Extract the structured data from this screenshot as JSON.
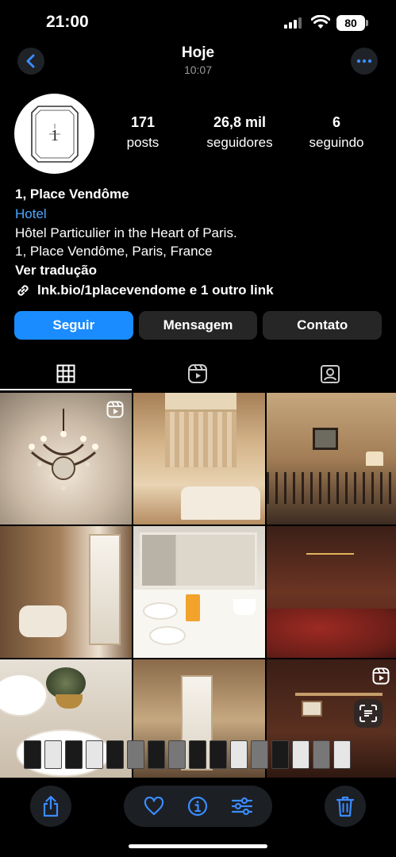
{
  "status_bar": {
    "time": "21:00",
    "battery": "80"
  },
  "header": {
    "title": "Hoje",
    "subtitle": "10:07"
  },
  "profile": {
    "stats": [
      {
        "value": "171",
        "label": "posts"
      },
      {
        "value": "26,8 mil",
        "label": "seguidores"
      },
      {
        "value": "6",
        "label": "seguindo"
      }
    ],
    "name": "1, Place Vendôme",
    "category": "Hotel",
    "bio_line1": "Hôtel Particulier in the Heart of Paris.",
    "bio_line2": "1, Place Vendôme, Paris, France",
    "translate": "Ver tradução",
    "link": "lnk.bio/1placevendome e 1 outro link"
  },
  "actions": {
    "follow": "Seguir",
    "message": "Mensagem",
    "contact": "Contato"
  },
  "tabs": [
    "grid-icon",
    "reels-icon",
    "tagged-icon"
  ],
  "toolbar": [
    "share-icon",
    "heart-icon",
    "info-icon",
    "adjust-icon",
    "trash-icon"
  ],
  "colors": {
    "accent": "#1a8cff",
    "link": "#4aa8ff",
    "background": "#000000",
    "button": "#262626"
  }
}
